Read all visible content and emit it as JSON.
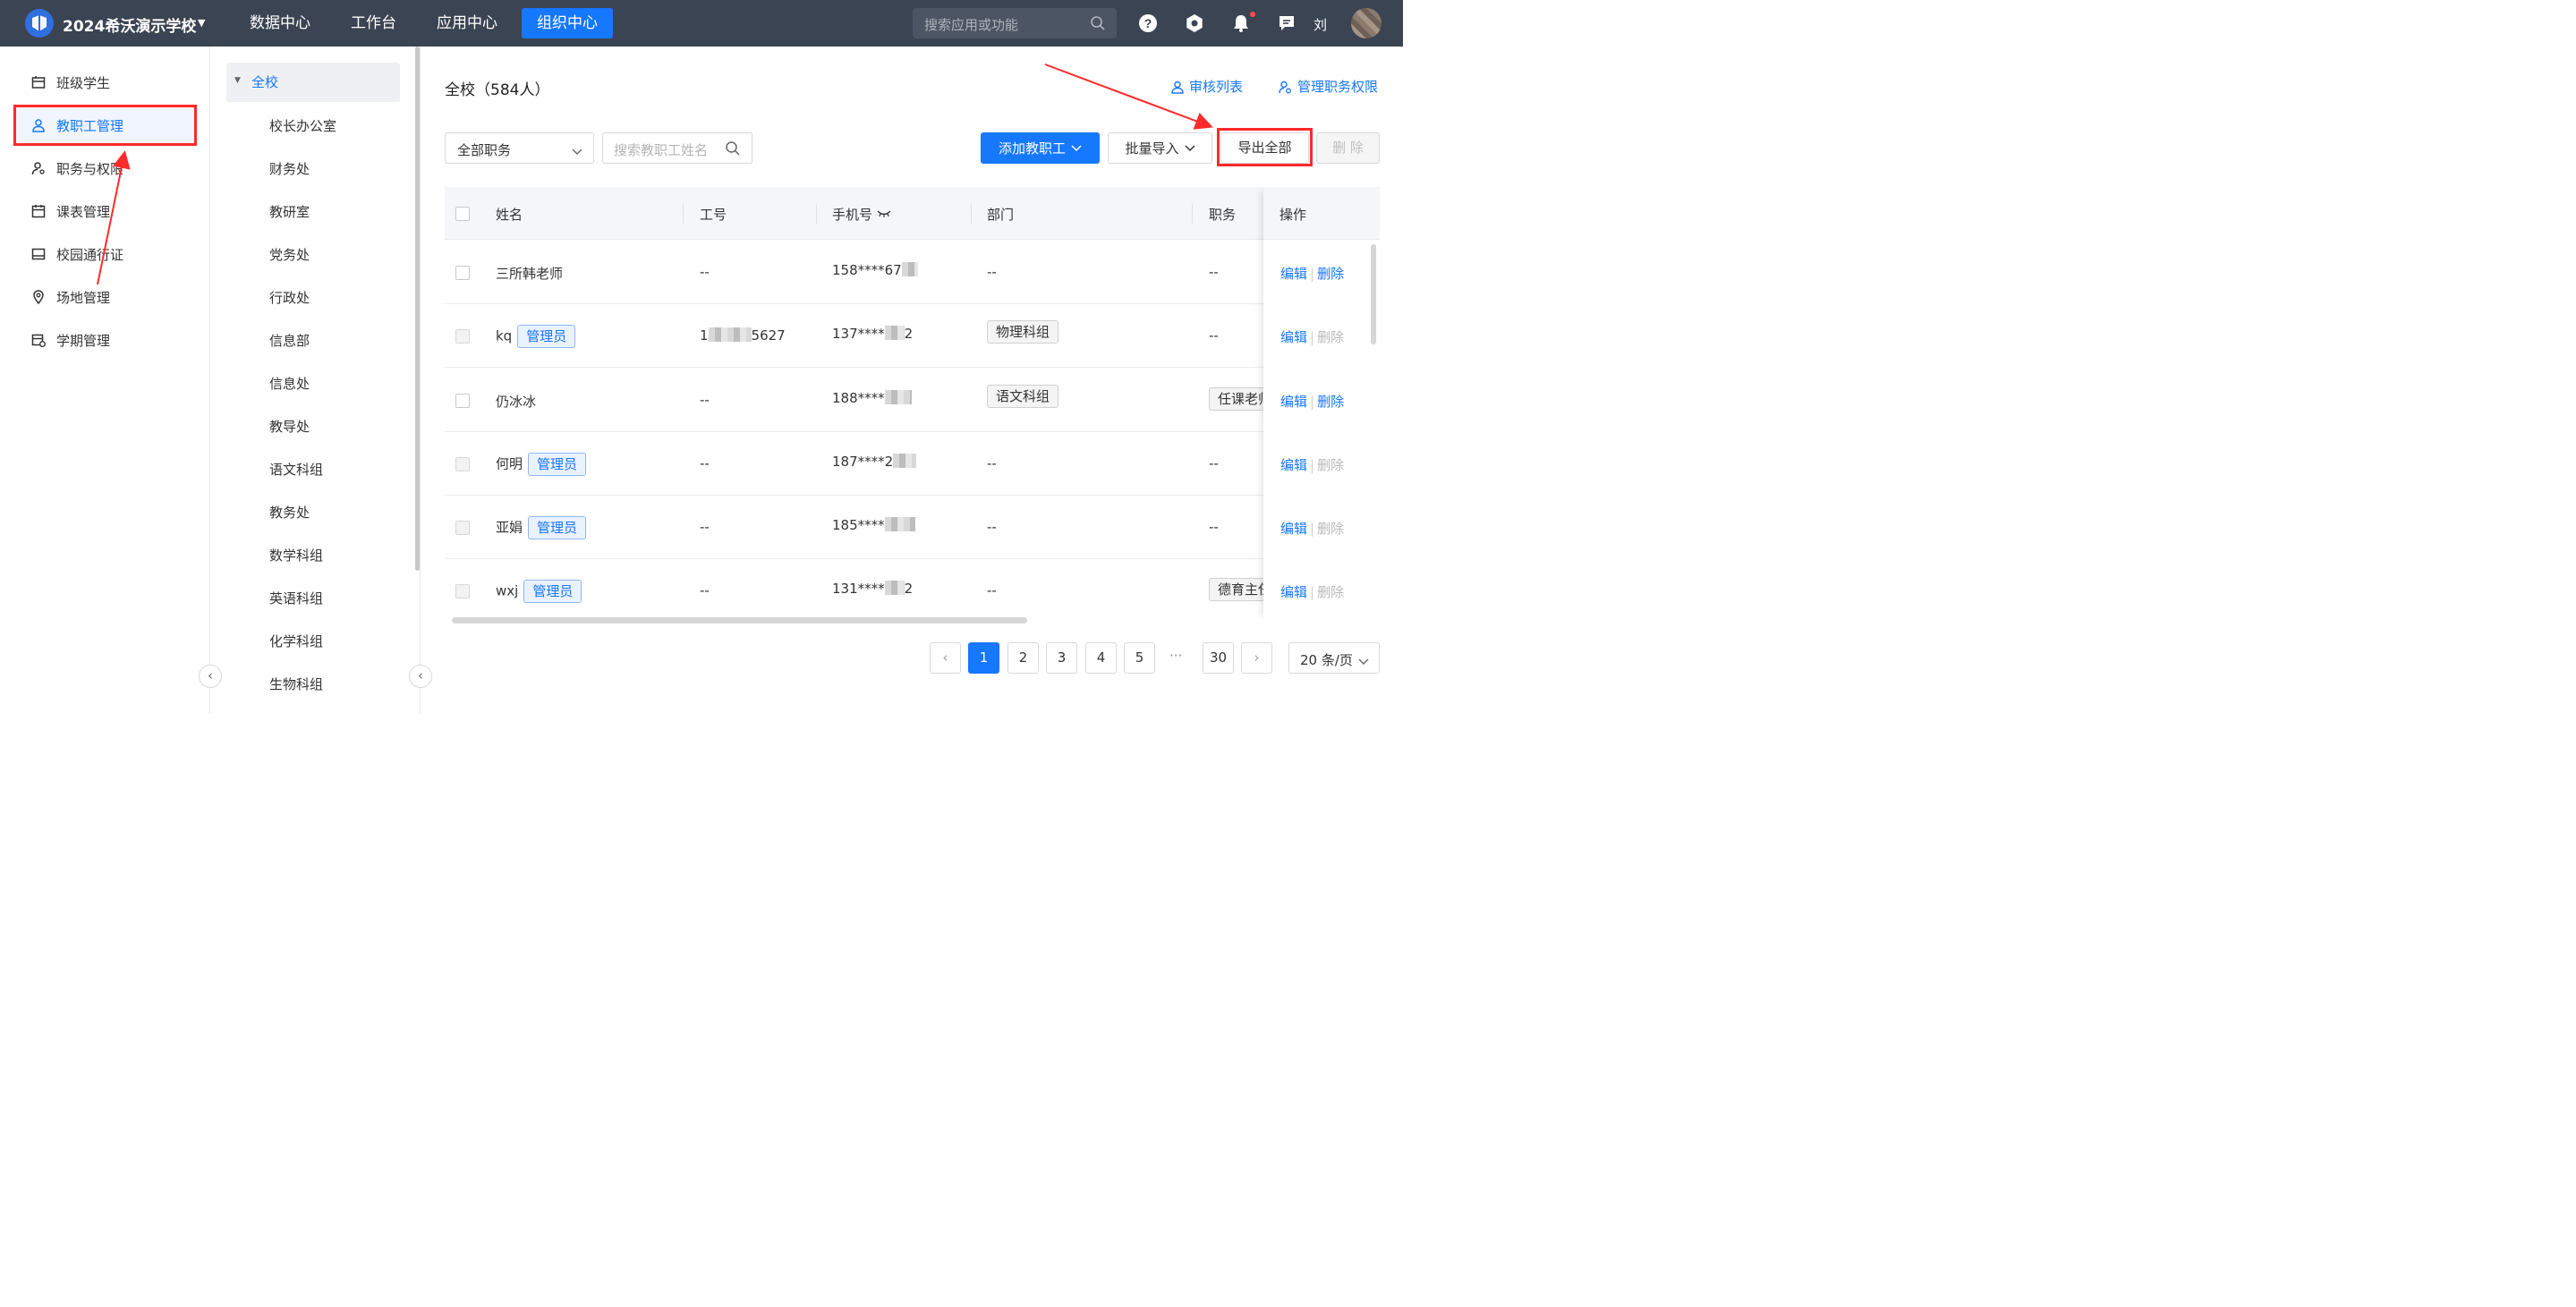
{
  "topbar": {
    "school_name": "2024希沃演示学校",
    "nav": [
      "数据中心",
      "工作台",
      "应用中心",
      "组织中心"
    ],
    "active_nav": "组织中心",
    "search_placeholder": "搜索应用或功能",
    "user_name": "刘"
  },
  "sidebar": {
    "items": [
      {
        "label": "班级学生",
        "icon": "class-icon"
      },
      {
        "label": "教职工管理",
        "icon": "user-icon"
      },
      {
        "label": "职务与权限",
        "icon": "user-key-icon"
      },
      {
        "label": "课表管理",
        "icon": "calendar-icon"
      },
      {
        "label": "校园通行证",
        "icon": "card-icon"
      },
      {
        "label": "场地管理",
        "icon": "location-icon"
      },
      {
        "label": "学期管理",
        "icon": "term-calendar-icon"
      }
    ],
    "active": "教职工管理"
  },
  "tree": {
    "root": "全校",
    "nodes": [
      "校长办公室",
      "财务处",
      "教研室",
      "党务处",
      "行政处",
      "信息部",
      "信息处",
      "教导处",
      "语文科组",
      "教务处",
      "数学科组",
      "英语科组",
      "化学科组",
      "生物科组"
    ]
  },
  "main": {
    "title": "全校（584人）",
    "review_list": "审核列表",
    "manage_permissions": "管理职务权限",
    "role_filter": "全部职务",
    "search_placeholder": "搜索教职工姓名",
    "add_staff": "添加教职工",
    "batch_import": "批量导入",
    "export_all": "导出全部",
    "delete": "删 除"
  },
  "table": {
    "columns": {
      "name": "姓名",
      "id": "工号",
      "phone": "手机号",
      "dept": "部门",
      "role": "职务",
      "ops": "操作"
    },
    "rows": [
      {
        "name": "三所韩老师",
        "tag": "",
        "id": "--",
        "phone": "158****67",
        "dept": "--",
        "dept_tag": false,
        "role": "--",
        "edit": "编辑",
        "delete": "删除",
        "delete_enabled": true,
        "checkbox_enabled": true
      },
      {
        "name": "kq",
        "tag": "管理员",
        "id": "1",
        "id_suffix": "5627",
        "phone": "137****",
        "phone_suffix": "2",
        "dept": "物理科组",
        "dept_tag": true,
        "role": "--",
        "edit": "编辑",
        "delete": "删除",
        "delete_enabled": false,
        "checkbox_enabled": false
      },
      {
        "name": "仍冰冰",
        "tag": "",
        "id": "--",
        "phone": "188****",
        "dept": "语文科组",
        "dept_tag": true,
        "role": "任课老师",
        "edit": "编辑",
        "delete": "删除",
        "delete_enabled": true,
        "checkbox_enabled": true
      },
      {
        "name": "何明",
        "tag": "管理员",
        "id": "--",
        "phone": "187****2",
        "dept": "--",
        "dept_tag": false,
        "role": "--",
        "edit": "编辑",
        "delete": "删除",
        "delete_enabled": false,
        "checkbox_enabled": false
      },
      {
        "name": "亚娟",
        "tag": "管理员",
        "id": "--",
        "phone": "185****",
        "dept": "--",
        "dept_tag": false,
        "role": "--",
        "edit": "编辑",
        "delete": "删除",
        "delete_enabled": false,
        "checkbox_enabled": false
      },
      {
        "name": "wxj",
        "tag": "管理员",
        "id": "--",
        "phone": "131****",
        "phone_suffix": "2",
        "dept": "--",
        "dept_tag": false,
        "role": "德育主任",
        "edit": "编辑",
        "delete": "删除",
        "delete_enabled": false,
        "checkbox_enabled": false
      }
    ]
  },
  "pagination": {
    "pages": [
      "1",
      "2",
      "3",
      "4",
      "5"
    ],
    "ellipsis": "···",
    "last": "30",
    "current": "1",
    "page_size": "20 条/页"
  },
  "colors": {
    "primary": "#1677ff",
    "topbar": "#3b4452",
    "highlight": "#ff2a2a"
  }
}
